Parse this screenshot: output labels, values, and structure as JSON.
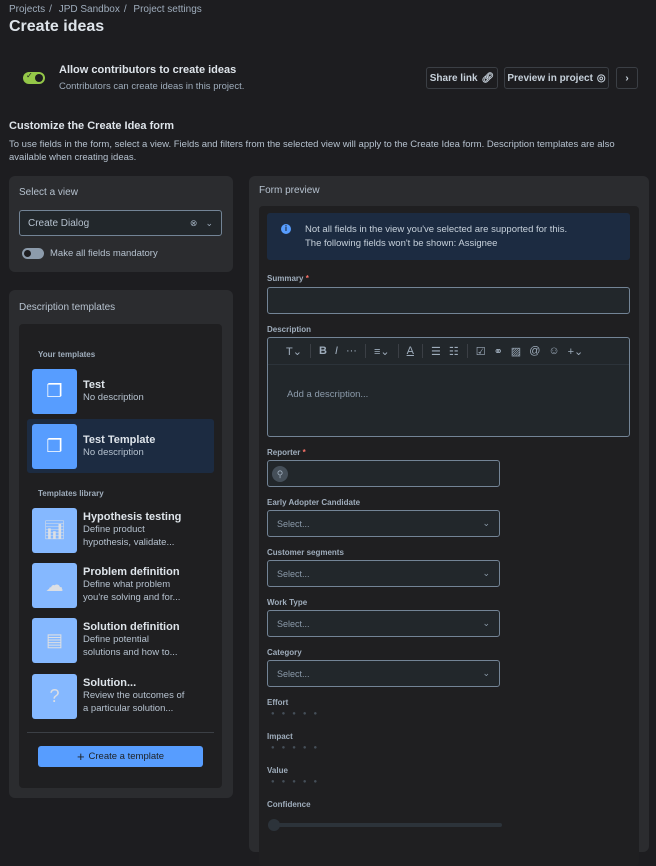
{
  "breadcrumbs": [
    "Projects",
    "JPD Sandbox",
    "Project settings"
  ],
  "title": "Create ideas",
  "allow": {
    "title": "Allow contributors to create ideas",
    "subtitle": "Contributors can create ideas in this project.",
    "enabled": true
  },
  "actions": {
    "share": "Share link",
    "preview": "Preview in project"
  },
  "customize": {
    "title": "Customize the Create Idea form",
    "text": "To use fields in the form, select a view. Fields and filters from the selected view will apply to the Create Idea form. Description templates are also available when creating ideas."
  },
  "view": {
    "title": "Select a view",
    "value": "Create Dialog",
    "mandatory": "Make all fields mandatory"
  },
  "templates": {
    "title": "Description templates",
    "your": "Your templates",
    "library": "Templates library",
    "create": "Create a template",
    "items": [
      {
        "name": "Test",
        "desc": "No description"
      },
      {
        "name": "Test Template",
        "desc": "No description"
      }
    ],
    "lib": [
      {
        "name": "Hypothesis testing",
        "desc": "Define product hypothesis, validate..."
      },
      {
        "name": "Problem definition",
        "desc": "Define what problem you're solving and for..."
      },
      {
        "name": "Solution definition",
        "desc": "Define potential solutions and how to..."
      },
      {
        "name": "Solution...",
        "desc": "Review the outcomes of a particular solution..."
      }
    ]
  },
  "preview": {
    "title": "Form preview",
    "notice1": "Not all fields in the view you've selected are supported for this.",
    "notice2": "The following fields won't be shown: Assignee",
    "summary": "Summary",
    "description": "Description",
    "desc_placeholder": "Add a description...",
    "reporter": "Reporter",
    "selects": [
      {
        "label": "Early Adopter Candidate",
        "placeholder": "Select..."
      },
      {
        "label": "Customer segments",
        "placeholder": "Select..."
      },
      {
        "label": "Work Type",
        "placeholder": "Select..."
      },
      {
        "label": "Category",
        "placeholder": "Select..."
      }
    ],
    "ratings": [
      "Effort",
      "Impact",
      "Value"
    ],
    "confidence": "Confidence",
    "req": "*"
  }
}
